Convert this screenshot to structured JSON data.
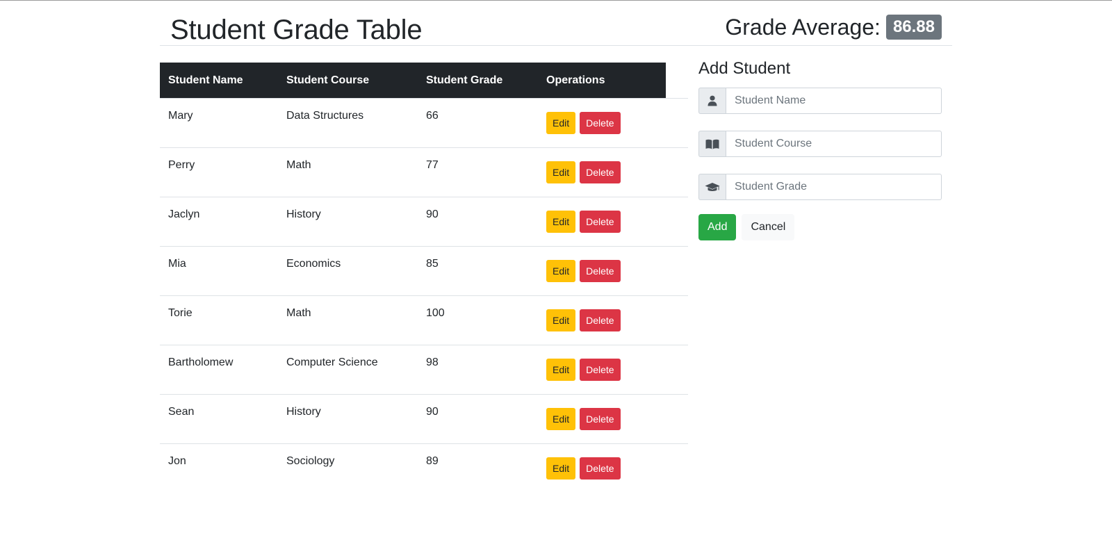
{
  "header": {
    "title": "Student Grade Table",
    "average_label": "Grade Average:",
    "average_value": "86.88"
  },
  "table": {
    "columns": [
      "Student Name",
      "Student Course",
      "Student Grade",
      "Operations"
    ],
    "edit_label": "Edit",
    "delete_label": "Delete",
    "rows": [
      {
        "name": "Mary",
        "course": "Data Structures",
        "grade": "66"
      },
      {
        "name": "Perry",
        "course": "Math",
        "grade": "77"
      },
      {
        "name": "Jaclyn",
        "course": "History",
        "grade": "90"
      },
      {
        "name": "Mia",
        "course": "Economics",
        "grade": "85"
      },
      {
        "name": "Torie",
        "course": "Math",
        "grade": "100"
      },
      {
        "name": "Bartholomew",
        "course": "Computer Science",
        "grade": "98"
      },
      {
        "name": "Sean",
        "course": "History",
        "grade": "90"
      },
      {
        "name": "Jon",
        "course": "Sociology",
        "grade": "89"
      }
    ]
  },
  "form": {
    "title": "Add Student",
    "fields": [
      {
        "icon": "user-icon",
        "placeholder": "Student Name",
        "value": ""
      },
      {
        "icon": "book-icon",
        "placeholder": "Student Course",
        "value": ""
      },
      {
        "icon": "graduation-cap-icon",
        "placeholder": "Student Grade",
        "value": ""
      }
    ],
    "add_label": "Add",
    "cancel_label": "Cancel"
  },
  "colors": {
    "table_header_bg": "#212529",
    "badge_bg": "#6c757d",
    "edit_button": "#ffc107",
    "delete_button": "#dc3545",
    "add_button": "#28a745",
    "cancel_button": "#f8f9fa"
  }
}
